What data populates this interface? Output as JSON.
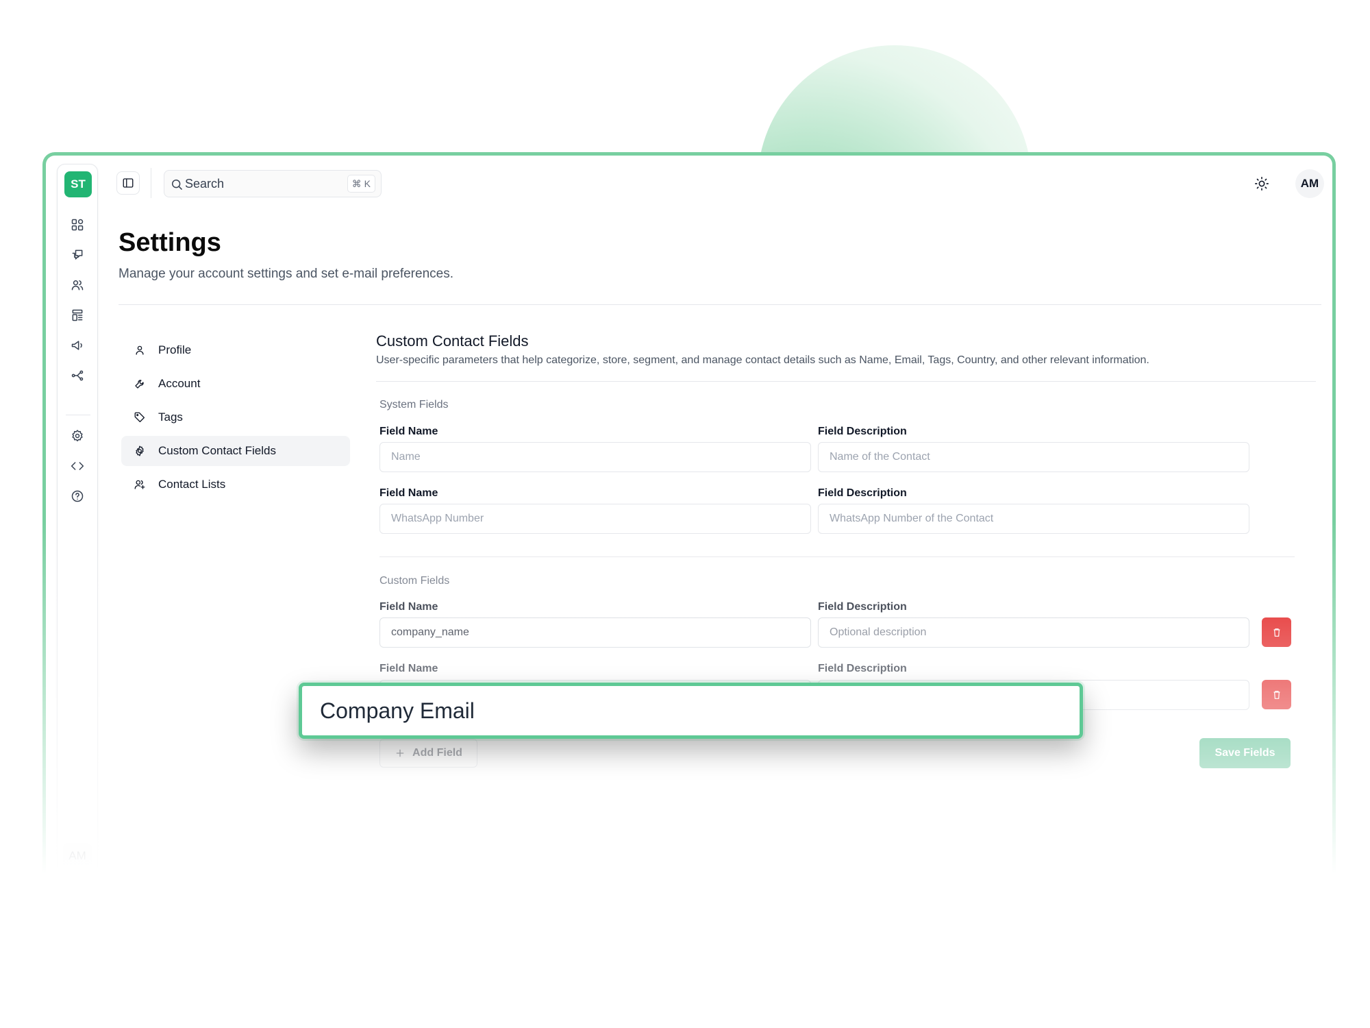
{
  "sidebar": {
    "logo": "ST",
    "icons": [
      "dashboard-icon",
      "chat-icon",
      "contacts-icon",
      "templates-icon",
      "campaigns-icon",
      "flows-icon",
      "settings-icon",
      "developer-icon",
      "help-icon"
    ],
    "avatar": "AM"
  },
  "topbar": {
    "search_placeholder": "Search",
    "search_shortcut": "⌘ K",
    "avatar": "AM"
  },
  "header": {
    "title": "Settings",
    "subtitle": "Manage your account settings and set e-mail preferences."
  },
  "settings_nav": [
    {
      "label": "Profile",
      "active": false
    },
    {
      "label": "Account",
      "active": false
    },
    {
      "label": "Tags",
      "active": false
    },
    {
      "label": "Custom Contact Fields",
      "active": true
    },
    {
      "label": "Contact Lists",
      "active": false
    }
  ],
  "section": {
    "title": "Custom Contact Fields",
    "description": "User-specific parameters that help categorize, store, segment, and manage contact details such as Name, Email, Tags, Country, and other relevant information."
  },
  "system_fields": {
    "label": "System Fields",
    "name_label": "Field Name",
    "desc_label": "Field Description",
    "rows": [
      {
        "name": "Name",
        "description": "Name of the Contact"
      },
      {
        "name": "WhatsApp Number",
        "description": "WhatsApp Number of the Contact"
      }
    ]
  },
  "custom_fields": {
    "label": "Custom Fields",
    "name_label": "Field Name",
    "desc_label": "Field Description",
    "rows": [
      {
        "name": "company_name",
        "description_placeholder": "Optional description"
      },
      {
        "name": "",
        "description_placeholder": ""
      }
    ]
  },
  "actions": {
    "add_field": "Add Field",
    "save_fields": "Save Fields"
  },
  "zoom_overlay": {
    "value": "Company Email"
  },
  "colors": {
    "brand_green": "#22b573",
    "frame_border": "#78cfa0",
    "danger_red": "#e00b0b"
  }
}
